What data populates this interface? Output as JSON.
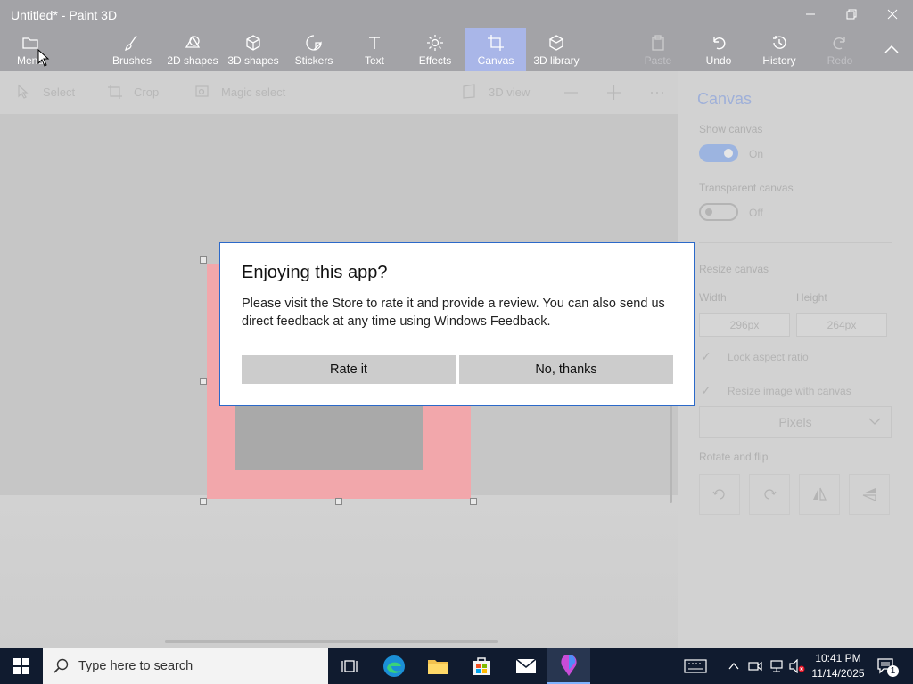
{
  "window": {
    "title": "Untitled* - Paint 3D",
    "controls": [
      "minimize-icon",
      "restore-icon",
      "close-icon"
    ]
  },
  "ribbon": {
    "items": [
      {
        "label": "Menu",
        "icon": "folder-icon"
      },
      {
        "label": "Brushes",
        "icon": "brush-icon"
      },
      {
        "label": "2D shapes",
        "icon": "2d-shapes-icon"
      },
      {
        "label": "3D shapes",
        "icon": "cube-icon"
      },
      {
        "label": "Stickers",
        "icon": "sticker-icon"
      },
      {
        "label": "Text",
        "icon": "text-icon"
      },
      {
        "label": "Effects",
        "icon": "sun-icon"
      },
      {
        "label": "Canvas",
        "icon": "canvas-icon",
        "active": true
      },
      {
        "label": "3D library",
        "icon": "library-icon"
      },
      {
        "label": "Paste",
        "icon": "paste-icon",
        "disabled": true
      },
      {
        "label": "Undo",
        "icon": "undo-icon"
      },
      {
        "label": "History",
        "icon": "history-icon"
      },
      {
        "label": "Redo",
        "icon": "redo-icon",
        "disabled": true
      }
    ]
  },
  "toolbar": {
    "select": "Select",
    "crop": "Crop",
    "magic_select": "Magic select",
    "view3d": "3D view"
  },
  "panel": {
    "title": "Canvas",
    "show_canvas_label": "Show canvas",
    "show_canvas_state": "On",
    "transparent_label": "Transparent canvas",
    "transparent_state": "Off",
    "resize_label": "Resize canvas",
    "width_label": "Width",
    "height_label": "Height",
    "width_value": "296px",
    "height_value": "264px",
    "lock_aspect": "Lock aspect ratio",
    "resize_with_canvas": "Resize image with canvas",
    "units": "Pixels",
    "rotate_flip_label": "Rotate and flip"
  },
  "dialog": {
    "title": "Enjoying this app?",
    "body": "Please visit the Store to rate it and provide a review. You can also send us direct feedback at any time using Windows Feedback.",
    "rate_button": "Rate it",
    "no_button": "No, thanks"
  },
  "taskbar": {
    "search_placeholder": "Type here to search",
    "time": "10:41 PM",
    "date": "11/14/2025",
    "notification_count": "1"
  },
  "colors": {
    "accent": "#2b69c9",
    "canvas_fill": "#f2a7ab",
    "taskbar": "#101b2f"
  }
}
